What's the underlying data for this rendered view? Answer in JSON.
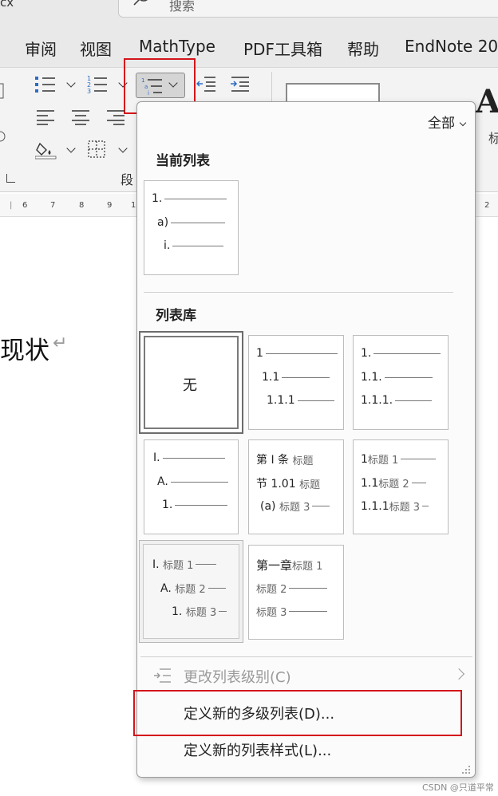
{
  "title_fragment": "cx",
  "search": {
    "placeholder": "搜索"
  },
  "menu": [
    "审阅",
    "视图",
    "MathType",
    "PDF工具箱",
    "帮助",
    "EndNote 20"
  ],
  "ribbon": {
    "group_label": "段"
  },
  "ruler_ticks": [
    "6",
    "7",
    "8",
    "9",
    "1"
  ],
  "ruler_tick_right": "2",
  "style_preview": {
    "glyph": "A",
    "label_fragment": "标"
  },
  "document": {
    "text": "现状",
    "paragraph_mark": "↵"
  },
  "dropdown": {
    "filter_label": "全部",
    "current_list": {
      "title": "当前列表",
      "levels": [
        "1.",
        "a)",
        "i."
      ]
    },
    "library": {
      "title": "列表库",
      "none_label": "无",
      "tiles": [
        {
          "lines": [
            {
              "num": "1",
              "heading": ""
            },
            {
              "num": "1.1",
              "heading": ""
            },
            {
              "num": "1.1.1",
              "heading": ""
            }
          ]
        },
        {
          "lines": [
            {
              "num": "1.",
              "heading": ""
            },
            {
              "num": "1.1.",
              "heading": ""
            },
            {
              "num": "1.1.1.",
              "heading": ""
            }
          ]
        },
        {
          "lines": [
            {
              "num": "I.",
              "heading": ""
            },
            {
              "num": "A.",
              "heading": ""
            },
            {
              "num": "1.",
              "heading": ""
            }
          ]
        },
        {
          "lines": [
            {
              "num": "第 I 条",
              "heading": "标题"
            },
            {
              "num": "节 1.01",
              "heading": "标题"
            },
            {
              "num": "(a)",
              "heading": "标题 3"
            }
          ]
        },
        {
          "lines": [
            {
              "num": "1",
              "heading": "标题 1"
            },
            {
              "num": "1.1",
              "heading": "标题 2"
            },
            {
              "num": "1.1.1",
              "heading": "标题 3"
            }
          ]
        },
        {
          "lines": [
            {
              "num": "I.",
              "heading": "标题 1"
            },
            {
              "num": "A.",
              "heading": "标题 2"
            },
            {
              "num": "1.",
              "heading": "标题 3"
            }
          ]
        },
        {
          "lines": [
            {
              "num": "第一章",
              "heading": "标题 1"
            },
            {
              "num": "",
              "heading": "标题 2"
            },
            {
              "num": "",
              "heading": "标题 3"
            }
          ]
        }
      ]
    },
    "commands": {
      "change_level": "更改列表级别(C)",
      "define_multilevel": "定义新的多级列表(D)...",
      "define_style": "定义新的列表样式(L)..."
    }
  },
  "watermark": "CSDN @只道平常",
  "colors": {
    "highlight": "#d4151b",
    "ribbon": "#f3f3f3",
    "menubar": "#e9e9e9"
  }
}
